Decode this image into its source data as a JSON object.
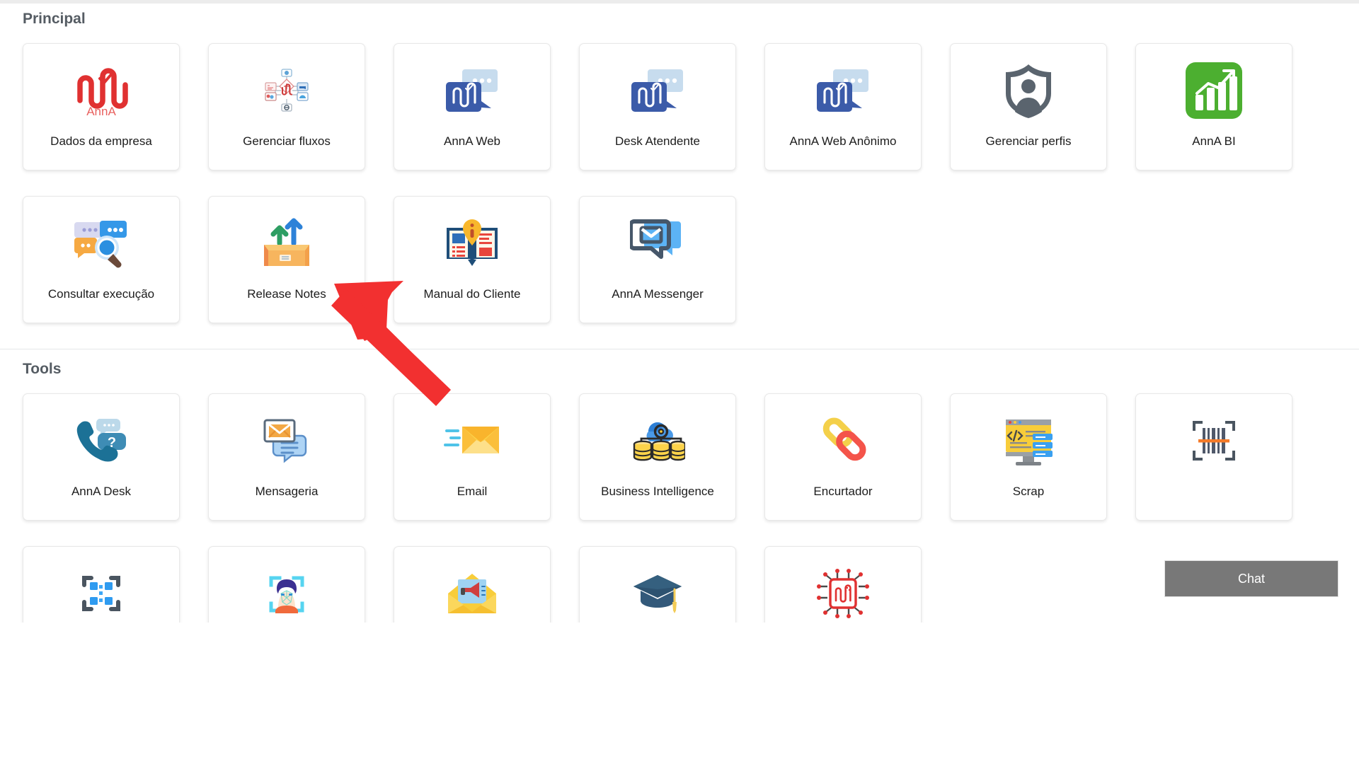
{
  "sections": [
    {
      "title": "Principal",
      "items": [
        {
          "label": "Dados da empresa",
          "icon": "anna-logo-icon"
        },
        {
          "label": "Gerenciar fluxos",
          "icon": "flow-diagram-icon"
        },
        {
          "label": "AnnA Web",
          "icon": "anna-chat-bubble-icon"
        },
        {
          "label": "Desk Atendente",
          "icon": "anna-chat-bubble-icon"
        },
        {
          "label": "AnnA Web Anônimo",
          "icon": "anna-chat-bubble-icon"
        },
        {
          "label": "Gerenciar perfis",
          "icon": "shield-user-icon"
        },
        {
          "label": "AnnA BI",
          "icon": "bar-chart-growth-icon"
        },
        {
          "label": "Consultar execução",
          "icon": "chat-search-icon"
        },
        {
          "label": "Release Notes",
          "icon": "box-arrows-up-icon"
        },
        {
          "label": "Manual do Cliente",
          "icon": "book-info-icon"
        },
        {
          "label": "AnnA Messenger",
          "icon": "messenger-envelope-icon"
        }
      ]
    },
    {
      "title": "Tools",
      "items": [
        {
          "label": "AnnA Desk",
          "icon": "phone-question-icon"
        },
        {
          "label": "Mensageria",
          "icon": "envelope-message-icon"
        },
        {
          "label": "Email",
          "icon": "email-send-icon"
        },
        {
          "label": "Business Intelligence",
          "icon": "cloud-database-icon"
        },
        {
          "label": "Encurtador",
          "icon": "link-chain-icon"
        },
        {
          "label": "Scrap",
          "icon": "monitor-code-icon"
        },
        {
          "label": "",
          "icon": "barcode-scan-icon"
        },
        {
          "label": "",
          "icon": "qr-code-icon"
        },
        {
          "label": "",
          "icon": "face-recognition-icon"
        },
        {
          "label": "",
          "icon": "envelope-megaphone-icon"
        },
        {
          "label": "",
          "icon": "graduation-cap-icon"
        },
        {
          "label": "",
          "icon": "ai-chip-icon"
        }
      ]
    }
  ],
  "chat": {
    "label": "Chat"
  },
  "annotation": {
    "type": "arrow",
    "color": "#f23030",
    "points_at": "Consultar execução"
  },
  "colors": {
    "anna_red": "#e03131",
    "anna_blue": "#3b5ba9",
    "bi_green": "#4caf30",
    "chat_button_bg": "#787878",
    "section_title": "#555c63",
    "card_border": "#e8e8e8"
  }
}
